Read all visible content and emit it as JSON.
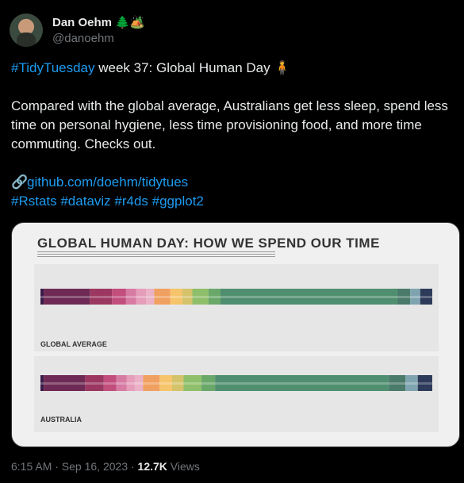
{
  "author": {
    "name": "Dan Oehm 🌲🏕️",
    "handle": "@danoehm"
  },
  "tweet": {
    "line1_tag": "#TidyTuesday",
    "line1_rest": " week 37: Global Human Day 🧍",
    "line2": "Compared with the global average, Australians get less sleep, spend less time on personal hygiene, less time provisioning food, and more time commuting. Checks out.",
    "link": "github.com/doehm/tidytues",
    "tags": "#Rstats #dataviz #r4ds #ggplot2",
    "link_icon": "🔗"
  },
  "image": {
    "title": "GLOBAL HUMAN DAY: HOW WE SPEND OUR TIME",
    "global_label": "GLOBAL AVERAGE",
    "aus_label": "AUSTRALIA"
  },
  "bar_colors": [
    "#3b1c4a",
    "#6e2a55",
    "#9b3760",
    "#c24e7c",
    "#d77ba3",
    "#e59db9",
    "#eab1c7",
    "#f0a060",
    "#f6c46a",
    "#d4c36a",
    "#8fbf6a",
    "#6aa86a",
    "#4f8f6f",
    "#4a7a6a",
    "#7fa4b0",
    "#2d3a5a"
  ],
  "bar_widths_global": [
    0.8,
    11.5,
    5.5,
    3.5,
    2.5,
    2.5,
    2.0,
    4.0,
    3.0,
    2.5,
    4.0,
    3.0,
    44.0,
    3.2,
    2.5,
    3.0
  ],
  "bar_widths_aus": [
    0.8,
    10.0,
    4.5,
    3.0,
    2.5,
    2.0,
    2.0,
    4.0,
    3.0,
    2.8,
    4.3,
    3.3,
    42.0,
    4.0,
    3.0,
    3.5
  ],
  "meta": {
    "time": "6:15 AM · Sep 16, 2023 · ",
    "views_count": "12.7K",
    "views_label": " Views"
  }
}
